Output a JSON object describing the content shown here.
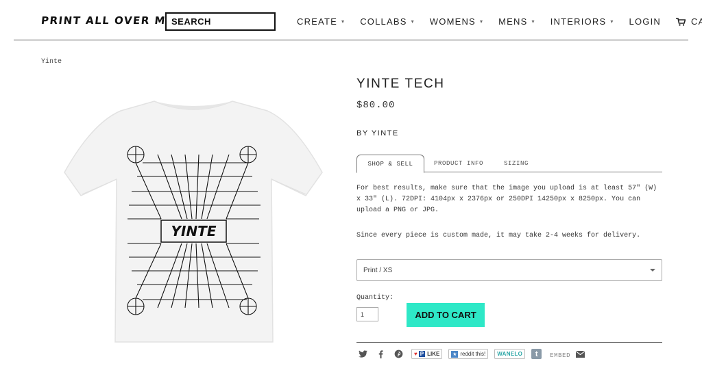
{
  "header": {
    "logo": "PRINT ALL OVER ME",
    "search_placeholder": "SEARCH",
    "nav": [
      {
        "label": "CREATE"
      },
      {
        "label": "COLLABS"
      },
      {
        "label": "WOMENS"
      },
      {
        "label": "MENS"
      },
      {
        "label": "INTERIORS"
      },
      {
        "label": "LOGIN"
      },
      {
        "label": "CART"
      }
    ]
  },
  "breadcrumb": "Yinte",
  "product": {
    "title": "YINTE TECH",
    "price": "$80.00",
    "byline": "BY YINTE",
    "image_text": "YINTE",
    "tabs": [
      "SHOP & SELL",
      "PRODUCT INFO",
      "SIZING"
    ],
    "info_1": "For best results, make sure that the image you upload is at least 57\" (W) x 33\" (L). 72DPI: 4104px x 2376px or 250DPI 14250px x 8250px. You can upload a PNG or JPG.",
    "info_2": "Since every piece is custom made, it may take 2-4 weeks for delivery.",
    "variant": "Print / XS",
    "quantity_label": "Quantity:",
    "quantity": "1",
    "add_to_cart": "ADD TO CART"
  },
  "share": {
    "like_p": "P",
    "like": "LIKE",
    "reddit": "reddit this!",
    "wanelo": "WANELO",
    "tumblr": "t",
    "embed": "EMBED"
  },
  "colors": {
    "accent": "#2ee8c7",
    "rule": "#555555"
  }
}
